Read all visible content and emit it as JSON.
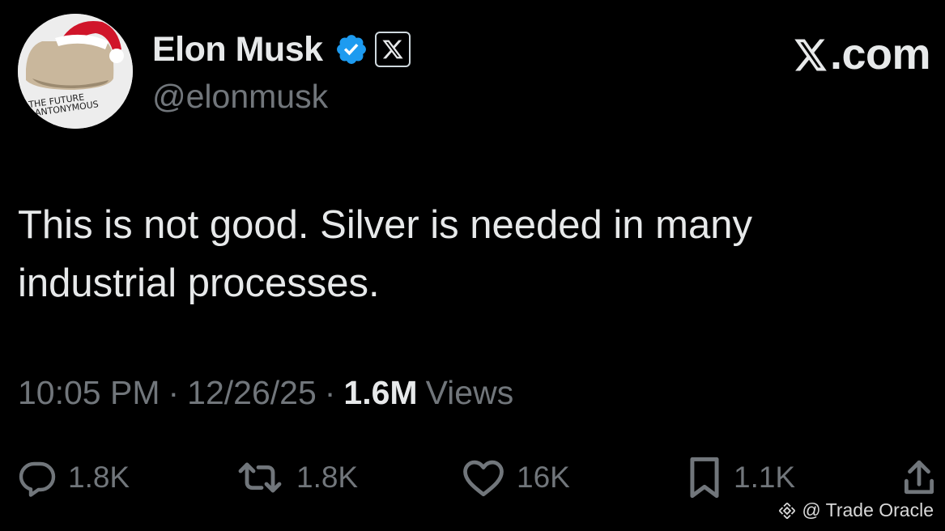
{
  "author": {
    "display_name": "Elon Musk",
    "handle": "@elonmusk",
    "verified_icon": "verified-checkmark-icon",
    "affiliate_badge_icon": "x-logo-icon",
    "avatar_text": "THE FUTURE IS ANTONYMOUS"
  },
  "brand": {
    "label": ".com",
    "logo_icon": "x-logo-icon"
  },
  "tweet": {
    "text": "This is not good. Silver is needed in many\nindustrial processes."
  },
  "meta": {
    "time": "10:05 PM",
    "separator": "·",
    "date": "12/26/25",
    "views_count": "1.6M",
    "views_label": "Views"
  },
  "actions": {
    "replies": "1.8K",
    "reposts": "1.8K",
    "likes": "16K",
    "bookmarks": "1.1K"
  },
  "watermark": {
    "text": "@ Trade Oracle",
    "logo_icon": "binance-logo-icon"
  },
  "colors": {
    "background": "#000000",
    "primary_text": "#e7e9ea",
    "secondary_text": "#71767b",
    "verified_blue": "#1d9bf0"
  }
}
